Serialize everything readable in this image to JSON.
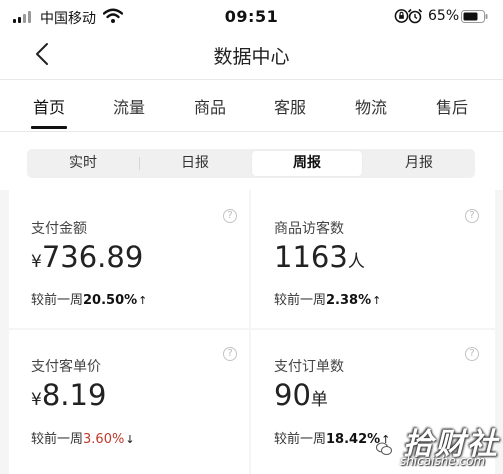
{
  "status_bar": {
    "carrier": "中国移动",
    "time": "09:51",
    "battery_percent": "65%"
  },
  "nav": {
    "title": "数据中心"
  },
  "tabs": [
    {
      "label": "首页",
      "active": true
    },
    {
      "label": "流量",
      "active": false
    },
    {
      "label": "商品",
      "active": false
    },
    {
      "label": "客服",
      "active": false
    },
    {
      "label": "物流",
      "active": false
    },
    {
      "label": "售后",
      "active": false
    }
  ],
  "period": {
    "options": [
      "实时",
      "日报",
      "周报",
      "月报"
    ],
    "selected": "周报"
  },
  "metrics": [
    {
      "label": "支付金额",
      "currency": "¥",
      "value": "736.89",
      "unit": "",
      "compare_label": "较前一周",
      "change": "20.50%",
      "direction": "up"
    },
    {
      "label": "商品访客数",
      "currency": "",
      "value": "1163",
      "unit": "人",
      "compare_label": "较前一周",
      "change": "2.38%",
      "direction": "up"
    },
    {
      "label": "支付客单价",
      "currency": "¥",
      "value": "8.19",
      "unit": "",
      "compare_label": "较前一周",
      "change": "3.60%",
      "direction": "down"
    },
    {
      "label": "支付订单数",
      "currency": "",
      "value": "90",
      "unit": "单",
      "compare_label": "较前一周",
      "change": "18.42%",
      "direction": "up"
    }
  ],
  "help_glyph": "?",
  "arrows": {
    "up": "↑",
    "down": "↓"
  },
  "watermark": {
    "text": "拾财社",
    "sub": "shicaishe.com"
  },
  "colors": {
    "accent": "#111111",
    "down": "#c0392b",
    "background": "#f5f5f5"
  }
}
